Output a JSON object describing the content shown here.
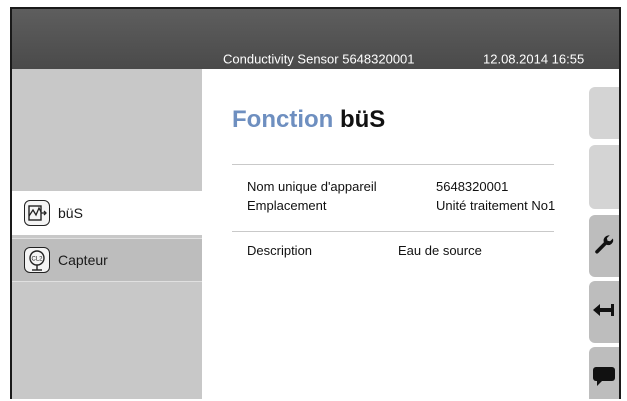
{
  "header": {
    "sensor": "Conductivity Sensor 5648320001",
    "datetime": "12.08.2014 16:55"
  },
  "sidebar": {
    "items": [
      {
        "label": "büS",
        "icon": "bus-network-icon"
      },
      {
        "label": "Capteur",
        "icon": "sensor-cl2-icon",
        "icon_text": "CL2"
      }
    ]
  },
  "main": {
    "title_prefix": "Fonction",
    "title_name": "büS",
    "fields": [
      {
        "label": "Nom unique d'appareil",
        "value": "5648320001"
      },
      {
        "label": "Emplacement",
        "value": "Unité traitement No1"
      },
      {
        "label": "Description",
        "value": "Eau de source"
      }
    ]
  },
  "right_toolbar": {
    "buttons": [
      "wrench-icon",
      "back-arrow-icon",
      "chat-icon"
    ]
  },
  "colors": {
    "header_bg": "#545454",
    "sidebar_bg": "#c8c8c8",
    "title_accent": "#6e8fc0",
    "button_bg": "#bdbdbd"
  }
}
